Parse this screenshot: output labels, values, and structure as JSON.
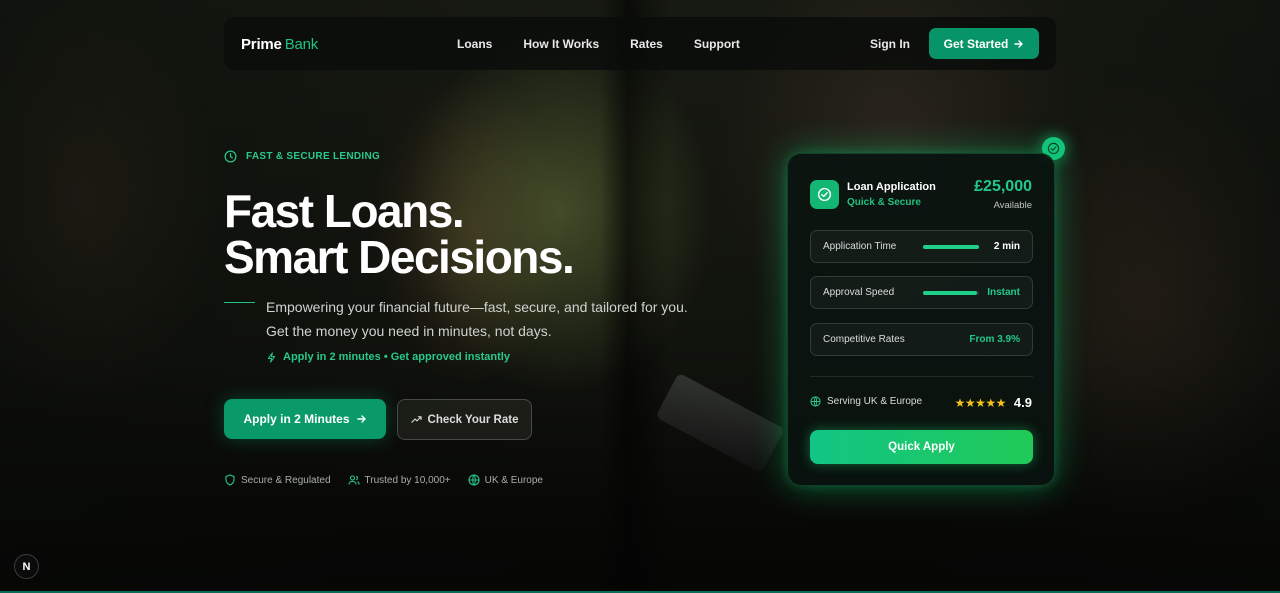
{
  "nav": {
    "logo_bold": "Prime",
    "logo_light": "Bank",
    "links": [
      "Loans",
      "How It Works",
      "Rates",
      "Support"
    ],
    "sign_in": "Sign In",
    "cta": "Get Started"
  },
  "hero": {
    "eyebrow": "FAST & SECURE LENDING",
    "headline_line1": "Fast Loans.",
    "headline_line2": "Smart Decisions.",
    "subtitle": "Empowering your financial future—fast, secure, and tailored for you. Get the money you need in minutes, not days.",
    "subnote": "Apply in 2 minutes • Get approved instantly",
    "primary_button": "Apply in 2 Minutes",
    "secondary_button": "Check Your Rate",
    "trust": [
      "Secure & Regulated",
      "Trusted by 10,000+",
      "UK & Europe"
    ]
  },
  "card": {
    "title": "Loan Application",
    "subtitle": "Quick & Secure",
    "amount": "£25,000",
    "amount_label": "Available",
    "stats": [
      {
        "label": "Application Time",
        "value": "2 min",
        "bar_fill": 1.0
      },
      {
        "label": "Approval Speed",
        "value": "Instant",
        "bar_fill": 0.97
      },
      {
        "label": "Competitive Rates",
        "value": "From 3.9%"
      }
    ],
    "serving": "Serving UK & Europe",
    "stars": "★★★★★",
    "rating": "4.9",
    "button": "Quick Apply"
  },
  "badge": "N",
  "colors": {
    "accent": "#22c17f",
    "button": "#079466",
    "star": "#f4c21b"
  }
}
